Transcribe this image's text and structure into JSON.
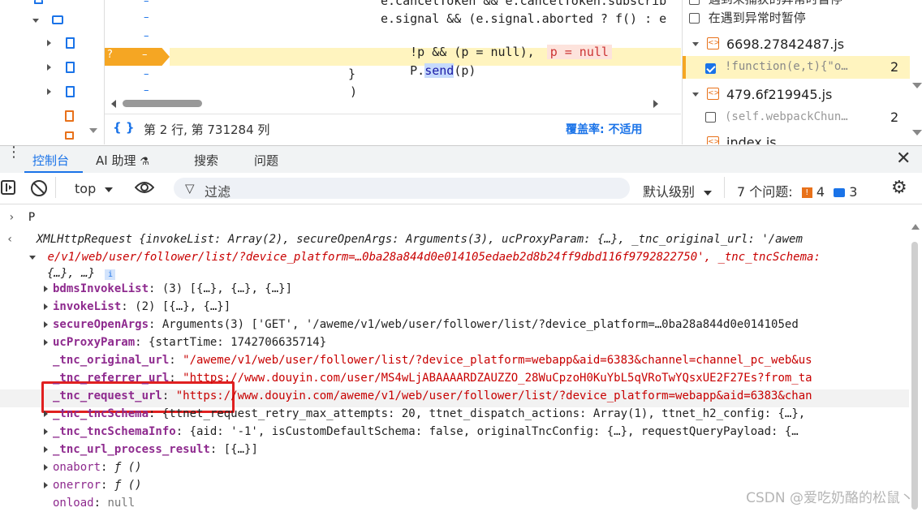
{
  "editor": {
    "code_lines": [
      "e.cancelToken && e.cancelToken.subscrib",
      "e.signal && (e.signal.aborted ? f() : e",
      "!p && (p = null),",
      "P.send(p)",
      "}",
      ")"
    ],
    "inline_value": "p = null",
    "breakpoint_marker": "?",
    "gutter_dash": "–",
    "status_position": "第 2 行, 第 731284 列",
    "coverage_label": "覆盖率: 不适用",
    "braces_icon": "{ }"
  },
  "right_panel": {
    "pause_uncaught": "遇到未捕获的异常时暂停",
    "pause_caught": "在遇到异常时暂停",
    "file1": "6698.27842487.js",
    "file1_bp": "!function(e,t){\"o…",
    "file1_count": "2",
    "file2": "479.6f219945.js",
    "file2_bp": "(self.webpackChun…",
    "file2_count": "2",
    "file3": "index.js"
  },
  "drawer_tabs": {
    "console": "控制台",
    "ai": "AI 助理",
    "search": "搜索",
    "issues": "问题"
  },
  "toolbar": {
    "context": "top",
    "filter_placeholder": "过滤",
    "levels": "默认级别",
    "issues_label": "7 个问题:",
    "issues_warn": "4",
    "issues_info": "3"
  },
  "console": {
    "input": "P",
    "summary_line1": "XMLHttpRequest {invokeList: Array(2), secureOpenArgs: Arguments(3), ucProxyParam: {…}, _tnc_original_url: '/awem",
    "summary_line2": "e/v1/web/user/follower/list/?device_platform=…0ba28a844d0e014105edaeb2d8b24ff9dbd116f9792822750', _tnc_tncSchema:",
    "summary_line3": "{…}, …}",
    "props": [
      {
        "key": "bdmsInvokeList",
        "value": "(3) [{…}, {…}, {…}]",
        "expandable": true
      },
      {
        "key": "invokeList",
        "value": "(2) [{…}, {…}]",
        "expandable": true
      },
      {
        "key": "secureOpenArgs",
        "value": "Arguments(3) ['GET', '/aweme/v1/web/user/follower/list/?device_platform=…0ba28a844d0e014105ed",
        "expandable": true
      },
      {
        "key": "ucProxyParam",
        "value": "{startTime: 1742706635714}",
        "expandable": true
      },
      {
        "key": "_tnc_original_url",
        "value": "\"/aweme/v1/web/user/follower/list/?device_platform=webapp&aid=6383&channel=channel_pc_web&us",
        "expandable": false
      },
      {
        "key": "_tnc_referrer_url",
        "value": "\"https://www.douyin.com/user/MS4wLjABAAAARDZAUZZO_28WuCpzoH0KuYbL5qVRoTwYQsxUE2F27Es?from_ta",
        "expandable": false
      },
      {
        "key": "_tnc_request_url",
        "value": "\"https://www.douyin.com/aweme/v1/web/user/follower/list/?device_platform=webapp&aid=6383&chan",
        "expandable": false
      },
      {
        "key": "_tnc_tncSchema",
        "value": "{ttnet_request_retry_max_attempts: 20, ttnet_dispatch_actions: Array(1), ttnet_h2_config: {…},",
        "expandable": true
      },
      {
        "key": "_tnc_tncSchemaInfo",
        "value": "{aid: '-1', isCustomDefaultSchema: false, originalTncConfig: {…}, requestQueryPayload: {…",
        "expandable": true
      },
      {
        "key": "_tnc_url_process_result",
        "value": "[{…}]",
        "expandable": true
      },
      {
        "key": "onabort",
        "value": "ƒ ()",
        "expandable": true
      },
      {
        "key": "onerror",
        "value": "ƒ ()",
        "expandable": true
      },
      {
        "key": "onload",
        "value": "null",
        "expandable": false
      }
    ]
  },
  "watermark": "CSDN @爱吃奶酪的松鼠丶",
  "colors": {
    "accent": "#1a73e8",
    "highlight_box": "#e02020",
    "breakpoint": "#f5a623"
  }
}
